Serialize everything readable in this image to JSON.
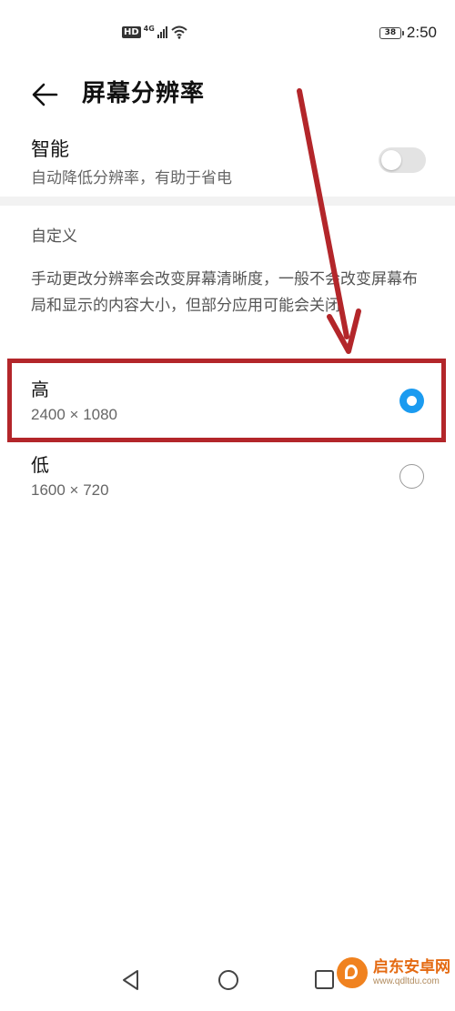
{
  "status_bar": {
    "hd_badge": "HD",
    "network_type": "4G",
    "battery_level": "38",
    "time": "2:50",
    "icons": [
      "hd-icon",
      "signal-icon",
      "wifi-icon",
      "battery-icon"
    ]
  },
  "header": {
    "back_icon": "arrow-left-icon",
    "title": "屏幕分辨率"
  },
  "smart": {
    "title": "智能",
    "subtitle": "自动降低分辨率，有助于省电",
    "toggle_on": false
  },
  "custom": {
    "label": "自定义",
    "description": "手动更改分辨率会改变屏幕清晰度，一般不会改变屏幕布局和显示的内容大小，但部分应用可能会关闭"
  },
  "options": [
    {
      "label": "高",
      "resolution": "2400 × 1080",
      "selected": true
    },
    {
      "label": "低",
      "resolution": "1600 × 720",
      "selected": false
    }
  ],
  "nav_bar": {
    "icons": [
      "back-triangle-icon",
      "home-circle-icon",
      "recents-square-icon"
    ]
  },
  "watermark": {
    "name": "启东安卓网",
    "url": "www.qdltdu.com"
  },
  "colors": {
    "accent": "#1b9bf0",
    "annotation": "#b3262a",
    "divider": "#f2f2f2"
  }
}
